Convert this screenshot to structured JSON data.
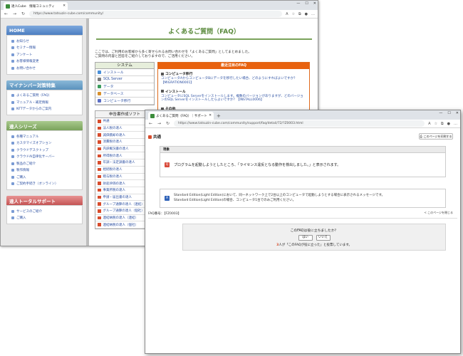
{
  "win1": {
    "tab_title": "達人Cube　情報コミュニティ",
    "url": "https://www.tatsuzin-cube.com/community/",
    "sidebar": [
      {
        "title": "HOME",
        "color": "blue",
        "items": [
          "お知らせ",
          "セミナー情報",
          "アンケート",
          "お客様情報変更",
          "お問い合わせ"
        ]
      },
      {
        "title": "マイナンバー対策特集",
        "color": "teal",
        "items": [
          "よくあるご質問（FAQ）",
          "マニュアル・補足情報",
          "NTTデータからのご案内"
        ]
      },
      {
        "title": "達人シリーズ",
        "color": "green",
        "items": [
          "各種マニュアル",
          "カスタマイズオプション",
          "クラウドデスクトップ",
          "クラウドAI自律化サーバー",
          "製品のご紹介",
          "製作情報",
          "ご購入",
          "ご契約手続き（オンライン）"
        ]
      },
      {
        "title": "達人トータルサポート",
        "color": "red",
        "items": [
          "サービスのご紹介",
          "ご購入"
        ]
      }
    ],
    "faq_title": "よくあるご質問（FAQ）",
    "intro_line1": "ここでは、ご利用のお客様から多く寄せられるお問い合わせを「よくあるご質問」としてまとめました。",
    "intro_line2": "ご質問の内容と回答をご紹介しておりますので、ご活用ください。",
    "system_header": "システム",
    "system_items": [
      "インストール",
      "SQL Server",
      "データ",
      "データベース",
      "コンピュータ移行"
    ],
    "featured_header": "最近注目のFAQ",
    "featured": [
      {
        "title": "コンピュータ移行",
        "desc": "コンピュータAからコンピュータBにデータを移行したい場合、どのようにすればよいですか？【MIGRATION0001】"
      },
      {
        "title": "インストール",
        "desc": "コンピュータにSQL Serverをインストールします。複数のバージョンがありますが、どのバージョンのSQL Serverをインストールしたらよいですか？【INSTALL0006】"
      },
      {
        "title": "その他",
        "desc": ""
      }
    ],
    "sales_header": "申告書作成ソフト",
    "sales_items": [
      "共通",
      "法人税の達人",
      "減価償却の達人",
      "消費税の達人",
      "内訳概況書の達人",
      "所得税の達人",
      "年調・法定調書の達人",
      "相続税の達人",
      "贈与税の達人",
      "財産評価の達人",
      "事業所税の達人",
      "申請・届出書の達人",
      "グループ通算の達人（連結）",
      "グループ通算の達人（個社）",
      "連結納税の達人（連結）",
      "連結納税の達人（個社）"
    ]
  },
  "win2": {
    "tab_title": "よくあるご質問（FAQ）｜サポート",
    "url": "https://www.tatsuzin-cube.com/community/support/faq/detail/72/?Z0003.html",
    "category": "共通",
    "print_label": "このページを印刷する",
    "question_label": "現象",
    "question_text": "プログラムを起動しようとしたところ、「ライセンス違反となる動作を検出しました。」と表示されます。",
    "answer_line1": "Standard Edition(Light Edition)において、同一ネットワーク上で2台以上のコンピュータで起動しようとする場合に表示されるメッセージです。",
    "answer_line2": "Standard Edition(Light Edition)の場合、コンピュータ1台でのみご利用ください。",
    "faq_number": "FAQ番号：【FZ0003】",
    "back_to_top": "< このページを閉じる",
    "helpful_q": "このFAQは役に立ちましたか？",
    "yes_label": "はい",
    "no_label": "いいえ",
    "helpful_count": "3",
    "helpful_suffix": "人が「このFAQが役に立った」と投票しています。"
  },
  "colors": {
    "accent_green": "#7aa35b",
    "accent_orange": "#e8620f",
    "link_blue": "#2b4fa1"
  }
}
